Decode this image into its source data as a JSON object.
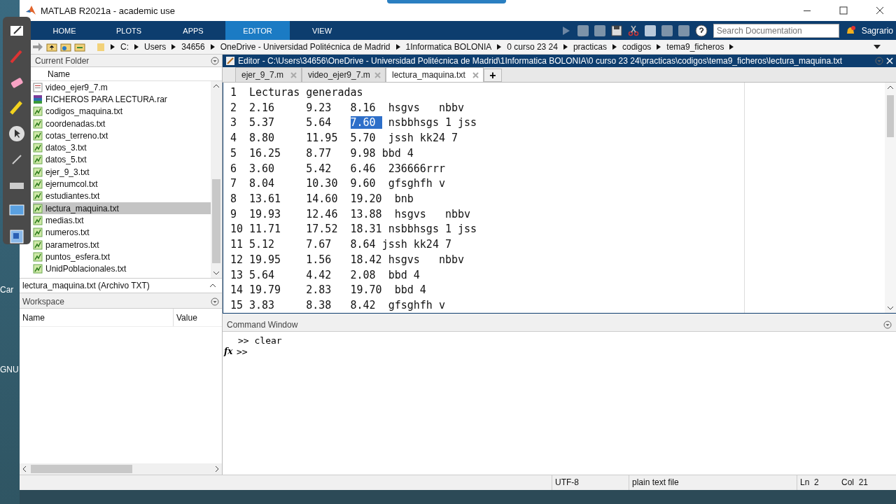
{
  "desktop": {
    "labels": [
      "Car",
      "GNU"
    ]
  },
  "window": {
    "title": "MATLAB R2021a - academic use"
  },
  "ribbon": {
    "tabs": [
      {
        "label": "HOME",
        "selected": false
      },
      {
        "label": "PLOTS",
        "selected": false
      },
      {
        "label": "APPS",
        "selected": false
      },
      {
        "label": "EDITOR",
        "selected": true
      },
      {
        "label": "VIEW",
        "selected": false
      }
    ],
    "search": {
      "placeholder": "Search Documentation"
    },
    "user": "Sagrario"
  },
  "address_bar": {
    "path": [
      "C:",
      "Users",
      "34656",
      "OneDrive - Universidad Politécnica de Madrid",
      "1Informatica BOLONIA",
      "0 curso 23 24",
      "practicas",
      "codigos",
      "tema9_ficheros"
    ]
  },
  "current_folder": {
    "title": "Current Folder",
    "column": "Name",
    "files": [
      {
        "name": "video_ejer9_7.m",
        "kind": "script",
        "selected": false
      },
      {
        "name": "FICHEROS PARA LECTURA.rar",
        "kind": "archive",
        "selected": false
      },
      {
        "name": "codigos_maquina.txt",
        "kind": "text",
        "selected": false
      },
      {
        "name": "coordenadas.txt",
        "kind": "text",
        "selected": false
      },
      {
        "name": "cotas_terreno.txt",
        "kind": "text",
        "selected": false
      },
      {
        "name": "datos_3.txt",
        "kind": "text",
        "selected": false
      },
      {
        "name": "datos_5.txt",
        "kind": "text",
        "selected": false
      },
      {
        "name": "ejer_9_3.txt",
        "kind": "text",
        "selected": false
      },
      {
        "name": "ejernumcol.txt",
        "kind": "text",
        "selected": false
      },
      {
        "name": "estudiantes.txt",
        "kind": "text",
        "selected": false
      },
      {
        "name": "lectura_maquina.txt",
        "kind": "text",
        "selected": true
      },
      {
        "name": "medias.txt",
        "kind": "text",
        "selected": false
      },
      {
        "name": "numeros.txt",
        "kind": "text",
        "selected": false
      },
      {
        "name": "parametros.txt",
        "kind": "text",
        "selected": false
      },
      {
        "name": "puntos_esfera.txt",
        "kind": "text",
        "selected": false
      },
      {
        "name": "UnidPoblacionales.txt",
        "kind": "text",
        "selected": false
      }
    ],
    "details": "lectura_maquina.txt  (Archivo TXT)"
  },
  "workspace": {
    "title": "Workspace",
    "columns": [
      "Name",
      "Value"
    ]
  },
  "editor": {
    "title": "Editor - C:\\Users\\34656\\OneDrive - Universidad Politécnica de Madrid\\1Informatica BOLONIA\\0 curso 23 24\\practicas\\codigos\\tema9_ficheros\\lectura_maquina.txt",
    "tabs": [
      {
        "label": "ejer_9_7.m",
        "selected": false
      },
      {
        "label": "video_ejer9_7.m",
        "selected": false
      },
      {
        "label": "lectura_maquina.txt",
        "selected": true
      }
    ],
    "add_tab": "+",
    "lines": [
      {
        "num": "1",
        "text": "Lecturas generadas"
      },
      {
        "num": "2",
        "text": "2.16     9.23   8.16  hsgvs   nbbv"
      },
      {
        "num": "3",
        "text": "5.37     5.64   ",
        "selected_text": "7.60 ",
        "after": " nsbbhsgs 1 jss"
      },
      {
        "num": "4",
        "text": "8.80     11.95  5.70  jssh kk24 7"
      },
      {
        "num": "5",
        "text": "16.25    8.77   9.98 bbd 4"
      },
      {
        "num": "6",
        "text": "3.60     5.42   6.46  236666rrr"
      },
      {
        "num": "7",
        "text": "8.04     10.30  9.60  gfsghfh v"
      },
      {
        "num": "8",
        "text": "13.61    14.60  19.20  bnb"
      },
      {
        "num": "9",
        "text": "19.93    12.46  13.88  hsgvs   nbbv"
      },
      {
        "num": "10",
        "text": "11.71    17.52  18.31 nsbbhsgs 1 jss"
      },
      {
        "num": "11",
        "text": "5.12     7.67   8.64 jssh kk24 7"
      },
      {
        "num": "12",
        "text": "19.95    1.56   18.42 hsgvs   nbbv"
      },
      {
        "num": "13",
        "text": "5.64     4.42   2.08  bbd 4"
      },
      {
        "num": "14",
        "text": "19.79    2.83   19.70  bbd 4"
      },
      {
        "num": "15",
        "text": "3.83     8.38   8.42  gfsghfh v"
      }
    ]
  },
  "command_window": {
    "title": "Command Window",
    "history": [
      ">> clear"
    ],
    "prompt": ">>",
    "fx": "fx"
  },
  "status_bar": {
    "encoding": "UTF-8",
    "file_type": "plain text file",
    "line": "Ln  2",
    "column": "Col  21"
  }
}
